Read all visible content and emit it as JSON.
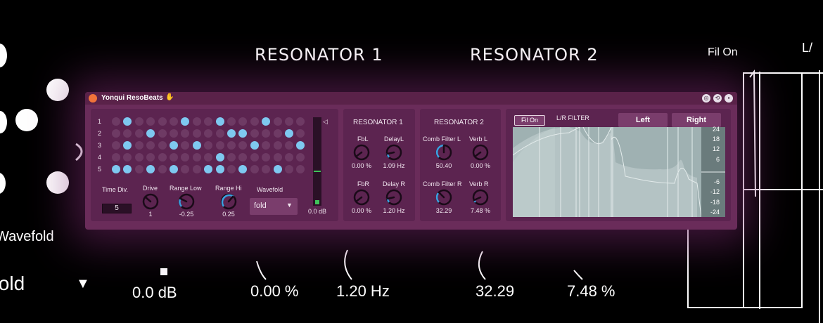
{
  "background": {
    "left_label": "Wavefold",
    "left_value": "fold",
    "resonator1_title": "RESONATOR 1",
    "resonator2_title": "RESONATOR 2",
    "fil_on": "Fil On",
    "lr_fragment": "L/",
    "readout_db": "0.0 dB",
    "readout_pct": "0.00 %",
    "readout_hz": "1.20 Hz",
    "readout_val": "32.29",
    "readout_pct2": "7.48 %"
  },
  "device": {
    "title": "Yonqui ResoBeats",
    "title_icon": "hand-icon",
    "window_buttons": [
      "settings-icon",
      "link-icon",
      "save-icon"
    ],
    "accent": "#7ec8f0",
    "panel_color": "#6a2c5a"
  },
  "sequencer": {
    "rows": [
      "1",
      "2",
      "3",
      "4",
      "5"
    ],
    "pattern": [
      [
        0,
        1,
        0,
        0,
        0,
        0,
        1,
        0,
        0,
        1,
        0,
        0,
        0,
        1,
        0,
        0,
        0
      ],
      [
        0,
        0,
        0,
        1,
        0,
        0,
        0,
        0,
        0,
        0,
        1,
        1,
        0,
        0,
        0,
        1,
        0
      ],
      [
        0,
        1,
        0,
        0,
        0,
        1,
        0,
        1,
        0,
        0,
        0,
        0,
        1,
        0,
        0,
        0,
        1
      ],
      [
        0,
        0,
        0,
        0,
        0,
        0,
        0,
        0,
        0,
        1,
        0,
        0,
        0,
        0,
        0,
        0,
        0
      ],
      [
        1,
        1,
        0,
        1,
        0,
        1,
        0,
        0,
        1,
        1,
        0,
        1,
        0,
        0,
        1,
        0,
        0
      ]
    ],
    "last_col_row4": 1
  },
  "controls": {
    "time_div_label": "Time Div.",
    "time_div_value": "5",
    "drive_label": "Drive",
    "drive_value": "1",
    "range_low_label": "Range Low",
    "range_low_value": "-0.25",
    "range_hi_label": "Range Hi",
    "range_hi_value": "0.25",
    "wavefold_label": "Wavefold",
    "wavefold_value": "fold",
    "meter_readout": "0.0 dB"
  },
  "resonator1": {
    "title": "RESONATOR 1",
    "fbl_label": "FbL",
    "fbl_value": "0.00 %",
    "delayl_label": "DelayL",
    "delayl_value": "1.09 Hz",
    "fbr_label": "FbR",
    "fbr_value": "0.00 %",
    "delayr_label": "Delay R",
    "delayr_value": "1.20 Hz"
  },
  "resonator2": {
    "title": "RESONATOR 2",
    "combl_label": "Comb Filter L",
    "combl_value": "50.40",
    "verbl_label": "Verb L",
    "verbl_value": "0.00 %",
    "combr_label": "Comb Filter R",
    "combr_value": "32.29",
    "verbr_label": "Verb R",
    "verbr_value": "7.48 %"
  },
  "filter": {
    "fil_on_label": "Fil On",
    "title": "L/R FILTER",
    "tab_left": "Left",
    "tab_right": "Right",
    "db_ticks": [
      "24",
      "18",
      "12",
      "6",
      "-6",
      "-12",
      "-18",
      "-24"
    ]
  }
}
